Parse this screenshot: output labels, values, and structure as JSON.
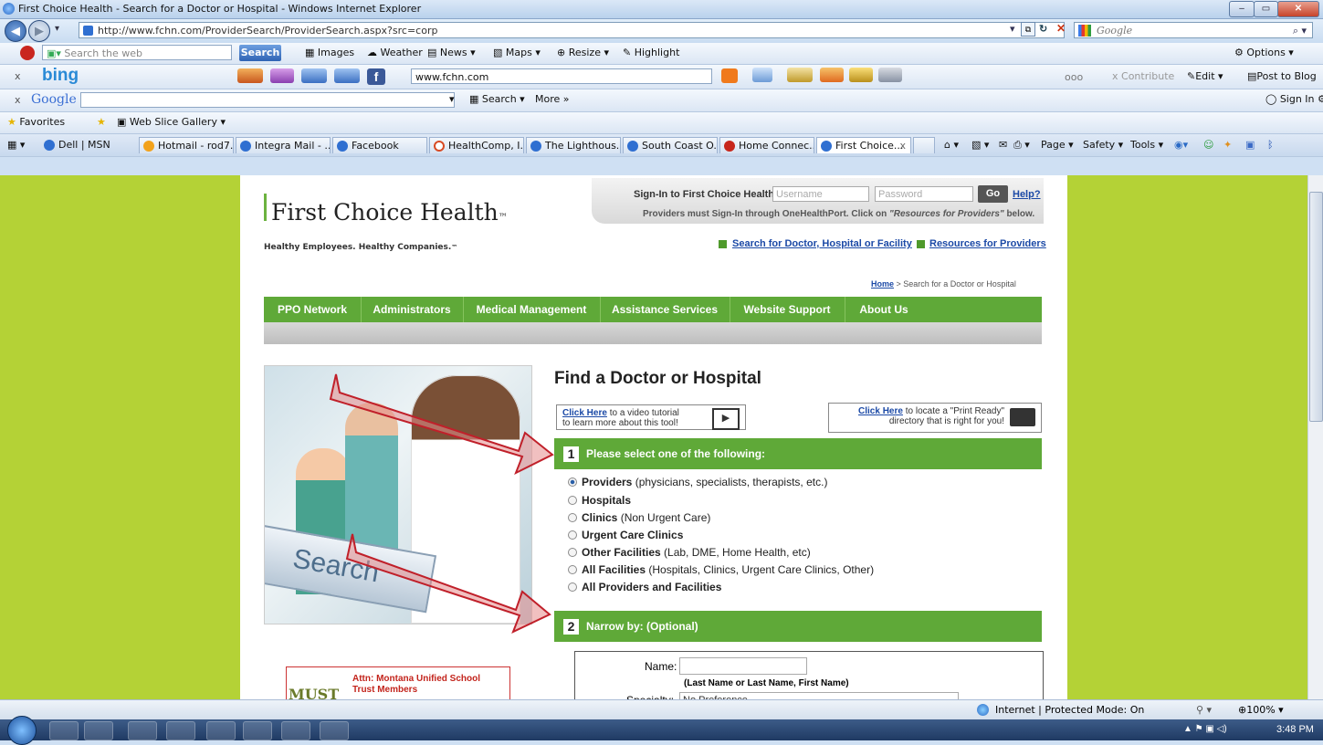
{
  "window": {
    "title": "First Choice Health - Search for a Doctor or Hospital - Windows Internet Explorer"
  },
  "address": {
    "url": "http://www.fchn.com/ProviderSearch/ProviderSearch.aspx?src=corp",
    "search_placeholder": "Google"
  },
  "ask_toolbar": {
    "search_placeholder": "Search the web",
    "search_button": "Search",
    "items": [
      "Images",
      "Weather",
      "News",
      "Maps",
      "Resize",
      "Highlight"
    ],
    "options": "Options"
  },
  "bing_toolbar": {
    "brand": "bing",
    "field_value": "www.fchn.com",
    "dots": "ooo",
    "contribute": "Contribute",
    "edit": "Edit",
    "post": "Post to Blog"
  },
  "google_toolbar": {
    "brand": "Google",
    "search": "Search",
    "more": "More »",
    "signin": "Sign In"
  },
  "favorites_bar": {
    "favorites": "Favorites",
    "web_slice": "Web Slice Gallery"
  },
  "tabs": [
    {
      "label": "Dell | MSN",
      "color": "#2f6fd1"
    },
    {
      "label": "Hotmail - rod7...",
      "color": "#f2a21b"
    },
    {
      "label": "Integra Mail - ...",
      "color": "#2f6fd1"
    },
    {
      "label": "Facebook",
      "color": "#2f6fd1"
    },
    {
      "label": "HealthComp, I...",
      "color": "#d84b24"
    },
    {
      "label": "The Lighthous...",
      "color": "#2f6fd1"
    },
    {
      "label": "South Coast O...",
      "color": "#2f6fd1"
    },
    {
      "label": "Home Connec...",
      "color": "#c7261b"
    },
    {
      "label": "First Choice...",
      "color": "#2f6fd1"
    }
  ],
  "command_bar": {
    "page": "Page",
    "safety": "Safety",
    "tools": "Tools"
  },
  "site": {
    "login_label": "Sign-In to First Choice Health:",
    "username_placeholder": "Username",
    "password_placeholder": "Password",
    "go": "Go",
    "help": "Help?",
    "login_note_prefix": "Providers must Sign-In through OneHealthPort. Click on ",
    "login_note_em": "\"Resources for Providers\"",
    "login_note_suffix": " below.",
    "logo": "First Choice Health",
    "logo_tm": "™",
    "tagline": "Healthy Employees. Healthy Companies.",
    "tagline_tm": "™",
    "link_search": "Search for Doctor, Hospital or Facility",
    "link_resources": "Resources for Providers",
    "breadcrumb_home": "Home",
    "breadcrumb_rest": " > Search for a Doctor or Hospital",
    "nav": [
      "PPO Network",
      "Administrators",
      "Medical Management",
      "Assistance Services",
      "Website Support",
      "About Us"
    ],
    "photo_text": "Search",
    "find_title": "Find a Doctor or Hospital",
    "video_link": "Click Here",
    "video_rest": " to a video tutorial",
    "video_line2": "to learn more about this tool!",
    "print_link": "Click Here",
    "print_rest": " to locate a \"Print Ready\"",
    "print_line2": "directory that is right for you!",
    "section1_num": "1",
    "section1_title": "Please select one of the following:",
    "options": [
      {
        "bold": "Providers",
        "rest": " (physicians, specialists, therapists, etc.)",
        "selected": true
      },
      {
        "bold": "Hospitals",
        "rest": "",
        "selected": false
      },
      {
        "bold": "Clinics",
        "rest": " (Non Urgent Care)",
        "selected": false
      },
      {
        "bold": "Urgent Care Clinics",
        "rest": "",
        "selected": false
      },
      {
        "bold": "Other Facilities",
        "rest": " (Lab, DME, Home Health, etc)",
        "selected": false
      },
      {
        "bold": "All Facilities",
        "rest": " (Hospitals, Clinics, Urgent Care Clinics, Other)",
        "selected": false
      },
      {
        "bold": "All Providers and Facilities",
        "rest": "",
        "selected": false
      }
    ],
    "section2_num": "2",
    "section2_title": "Narrow by: (Optional)",
    "name_label": "Name:",
    "name_hint": "(Last Name or Last Name, First Name)",
    "specialty_label": "Specialty:",
    "specialty_value": "No Preference",
    "attn_line1": "Attn:  Montana Unified School",
    "attn_line2": "Trust Members",
    "attn_logo": "MUST"
  },
  "status": {
    "zone": "Internet | Protected Mode: On",
    "zoom": "100%"
  },
  "taskbar": {
    "clock": "3:48 PM"
  }
}
